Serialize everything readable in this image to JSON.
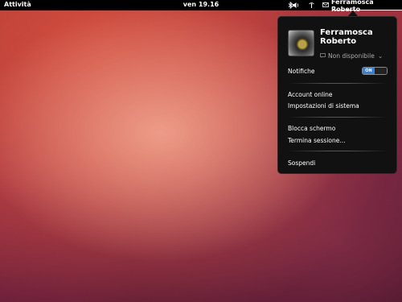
{
  "topbar": {
    "activities_label": "Attività",
    "clock": "ven 19.16",
    "user_name": "Ferramosca Roberto",
    "icons": [
      "bluetooth-icon",
      "volume-icon",
      "network-icon",
      "mail-icon"
    ]
  },
  "user_menu": {
    "name_line1": "Ferramosca",
    "name_line2": "Roberto",
    "presence": "Non disponibile",
    "notifications_label": "Notifiche",
    "notifications_on": "ON",
    "notifications_off": "",
    "items": {
      "online_accounts": "Account online",
      "system_settings": "Impostazioni di sistema",
      "lock_screen": "Blocca schermo",
      "log_out": "Termina sessione...",
      "suspend": "Sospendi"
    }
  },
  "colors": {
    "topbar_bg": "#000000",
    "menu_bg": "#111111",
    "toggle_on": "#3f7fd0"
  }
}
